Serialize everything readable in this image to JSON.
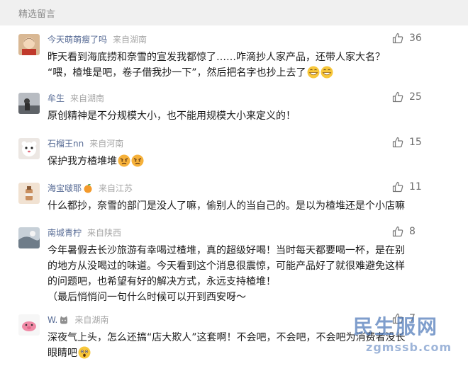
{
  "section": {
    "title": "精选留言"
  },
  "comments": [
    {
      "nickname": "今天萌萌瘦了吗",
      "location": "来自湖南",
      "likes": "36",
      "lines": [
        "昨天看到海底捞和奈雪的宣发我都惊了……咋滴抄人家产品，还带人家大名？",
        "“喂，楂堆是吧，卷子借我抄一下”，然后把名字也抄上去了"
      ],
      "avatar_color": "#c9a27a"
    },
    {
      "nickname": "牟生",
      "location": "来自湖南",
      "likes": "25",
      "lines": [
        "原创精神是不分规模大小，也不能用规模大小来定义的！"
      ],
      "avatar_color": "#7a7f86"
    },
    {
      "nickname": "石榴王nn",
      "location": "来自河南",
      "likes": "15",
      "lines": [
        "保护我方楂堆堆"
      ],
      "avatar_color": "#e9e4e0"
    },
    {
      "nickname": "海宝啵耶",
      "location": "来自江苏",
      "likes": "11",
      "lines": [
        "什么都抄，奈雪的部门是没人了嘛，偷别人的当自己的。是以为楂堆还是个小店嘛"
      ],
      "avatar_color": "#d7a77e"
    },
    {
      "nickname": "南城青柠",
      "location": "来自陕西",
      "likes": "8",
      "lines": [
        "今年暑假去长沙旅游有幸喝过楂堆，真的超级好喝！当时每天都要喝一杯，是在别",
        "的地方从没喝过的味道。今天看到这个消息很震惊，可能产品好了就很难避免这样",
        "的问题吧，也希望有好的解决方式，永远支持楂堆！",
        "（最后悄悄问一句什么时候可以开到西安呀～"
      ],
      "avatar_color": "#9aa7b3"
    },
    {
      "nickname": "W.",
      "location": "来自湖南",
      "likes": "7",
      "lines": [
        "深夜气上头，怎么还搞“店大欺人”这套啊！不会吧，不会吧，不会吧为消费者没长",
        "眼睛吧"
      ],
      "avatar_color": "#f2f2f2"
    }
  ],
  "watermark": {
    "text": "民生服网",
    "url": "zgmssb.com"
  }
}
